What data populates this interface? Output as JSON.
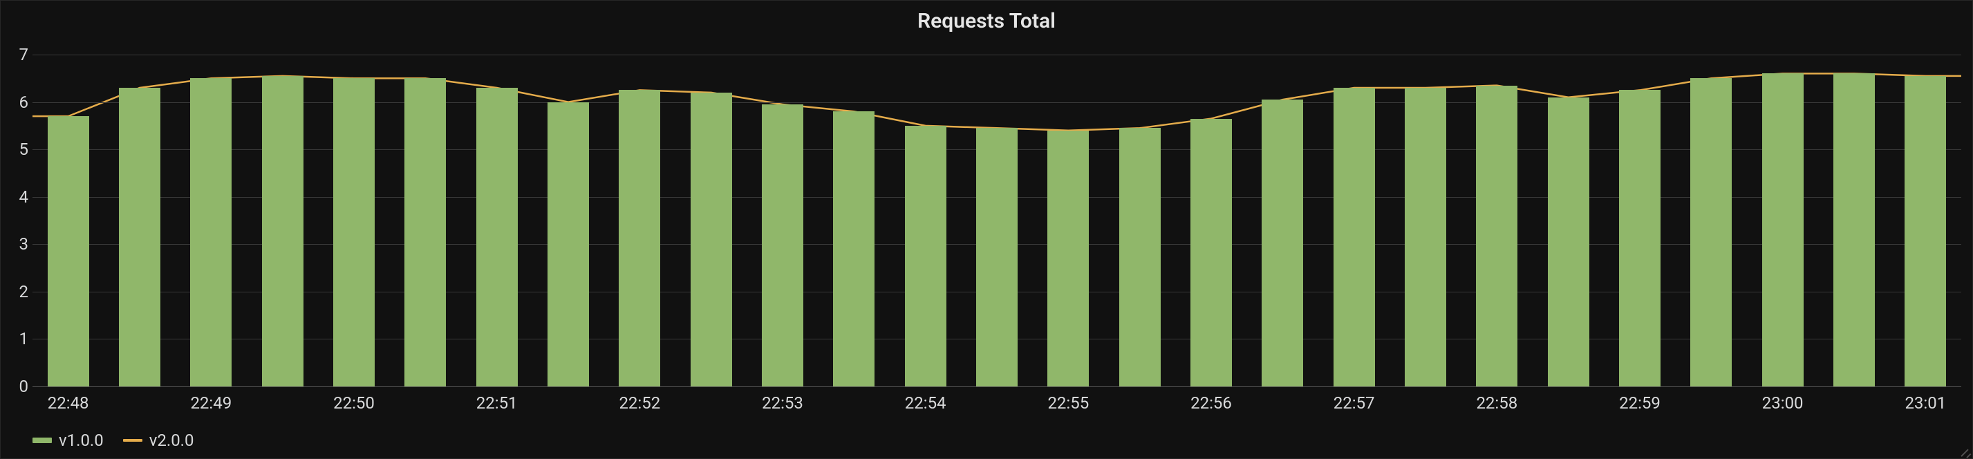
{
  "panel": {
    "title": "Requests Total"
  },
  "legend": {
    "series1": "v1.0.0",
    "series2": "v2.0.0"
  },
  "colors": {
    "bars": "#90b76a",
    "line": "#e5ac4b",
    "grid": "#3a3a3a",
    "bg": "#111111",
    "text": "#d8d9da"
  },
  "chart_data": {
    "type": "bar",
    "title": "Requests Total",
    "xlabel": "",
    "ylabel": "",
    "ylim": [
      0,
      7
    ],
    "yticks": [
      0,
      1,
      2,
      3,
      4,
      5,
      6,
      7
    ],
    "x_tick_labels": [
      "22:48",
      "22:49",
      "22:50",
      "22:51",
      "22:52",
      "22:53",
      "22:54",
      "22:55",
      "22:56",
      "22:57",
      "22:58",
      "22:59",
      "23:00",
      "23:01"
    ],
    "x_tick_bar_indices": [
      0,
      2,
      4,
      6,
      8,
      10,
      12,
      14,
      16,
      18,
      20,
      22,
      24,
      26
    ],
    "bar_count": 27,
    "series": [
      {
        "name": "v1.0.0",
        "style": "bar",
        "values": [
          5.7,
          6.3,
          6.5,
          6.55,
          6.5,
          6.5,
          6.3,
          6.0,
          6.25,
          6.2,
          5.95,
          5.8,
          5.5,
          5.45,
          5.4,
          5.45,
          5.65,
          6.05,
          6.3,
          6.3,
          6.35,
          6.1,
          6.25,
          6.5,
          6.6,
          6.6,
          6.55
        ]
      },
      {
        "name": "v2.0.0",
        "style": "line",
        "values": [
          5.7,
          6.3,
          6.5,
          6.55,
          6.5,
          6.5,
          6.3,
          6.0,
          6.25,
          6.2,
          5.95,
          5.8,
          5.5,
          5.45,
          5.4,
          5.45,
          5.65,
          6.05,
          6.3,
          6.3,
          6.35,
          6.1,
          6.25,
          6.5,
          6.6,
          6.6,
          6.55
        ]
      }
    ]
  }
}
